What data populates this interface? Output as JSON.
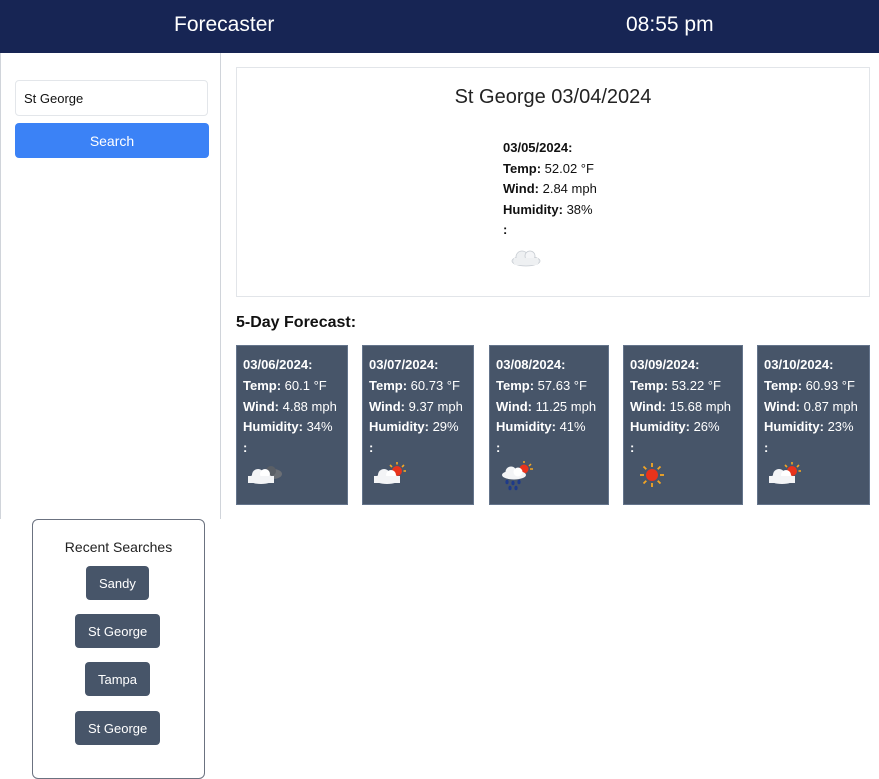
{
  "header": {
    "title": "Forecaster",
    "clock": "08:55 pm"
  },
  "search": {
    "value": "St George",
    "button_label": "Search"
  },
  "current": {
    "title": "St George 03/04/2024",
    "date": "03/05/2024:",
    "temp_label": "Temp:",
    "temp": " 52.02 °F",
    "wind_label": "Wind:",
    "wind": " 2.84 mph",
    "humidity_label": "Humidity:",
    "humidity": " 38%",
    "extra": ":",
    "icon": "cloud-icon"
  },
  "forecast": {
    "heading": "5-Day Forecast:",
    "days": [
      {
        "date": "03/06/2024:",
        "temp_label": "Temp:",
        "temp": " 60.1 °F",
        "wind_label": "Wind:",
        "wind": " 4.88 mph",
        "humidity_label": "Humidity:",
        "humidity": " 34%",
        "extra": ":",
        "icon": "cloudy-night-icon"
      },
      {
        "date": "03/07/2024:",
        "temp_label": "Temp:",
        "temp": " 60.73 °F",
        "wind_label": "Wind:",
        "wind": " 9.37 mph",
        "humidity_label": "Humidity:",
        "humidity": " 29%",
        "extra": ":",
        "icon": "partly-sunny-icon"
      },
      {
        "date": "03/08/2024:",
        "temp_label": "Temp:",
        "temp": " 57.63 °F",
        "wind_label": "Wind:",
        "wind": " 11.25 mph",
        "humidity_label": "Humidity:",
        "humidity": " 41%",
        "extra": ":",
        "icon": "rain-sun-icon"
      },
      {
        "date": "03/09/2024:",
        "temp_label": "Temp:",
        "temp": " 53.22 °F",
        "wind_label": "Wind:",
        "wind": " 15.68 mph",
        "humidity_label": "Humidity:",
        "humidity": " 26%",
        "extra": ":",
        "icon": "sun-icon"
      },
      {
        "date": "03/10/2024:",
        "temp_label": "Temp:",
        "temp": " 60.93 °F",
        "wind_label": "Wind:",
        "wind": " 0.87 mph",
        "humidity_label": "Humidity:",
        "humidity": " 23%",
        "extra": ":",
        "icon": "partly-sunny-icon"
      }
    ]
  },
  "recent": {
    "title": "Recent Searches",
    "items": [
      "Sandy",
      "St George",
      "Tampa",
      "St George"
    ]
  },
  "colors": {
    "header_bg": "#172554",
    "search_button": "#3b82f6",
    "card_bg": "#475569"
  }
}
